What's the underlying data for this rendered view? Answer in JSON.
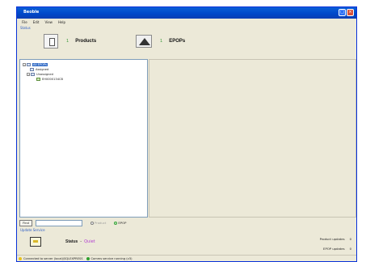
{
  "window": {
    "title": "Beoble"
  },
  "menu": [
    "File",
    "Edit",
    "View",
    "Help"
  ],
  "status_panel": {
    "caption": "Status",
    "products": {
      "count": "1",
      "label": "Products",
      "icon": "document-icon"
    },
    "epops": {
      "count": "1",
      "label": "EPOPs",
      "icon": "image-icon"
    }
  },
  "tree": {
    "root": "All EPOPs",
    "assigned": "Assigned",
    "unassigned": "Unassigned",
    "item": "EH0000134CB"
  },
  "find": {
    "button_label": "Find",
    "input_value": "",
    "radio_product": "Product",
    "radio_epop": "EPOP"
  },
  "update_service": {
    "caption": "Update Service",
    "status_label": "Status",
    "status_value": "Quiet",
    "product_updates_label": "Product updates",
    "product_updates_value": "0",
    "epop_updates_label": "EPOP updates",
    "epop_updates_value": "0",
    "status_color": "#b03ad0"
  },
  "statusbar": {
    "connection_text": "Connected to server (local)\\SQLEXPRESS",
    "service_text": "Comms service running (v3)"
  }
}
